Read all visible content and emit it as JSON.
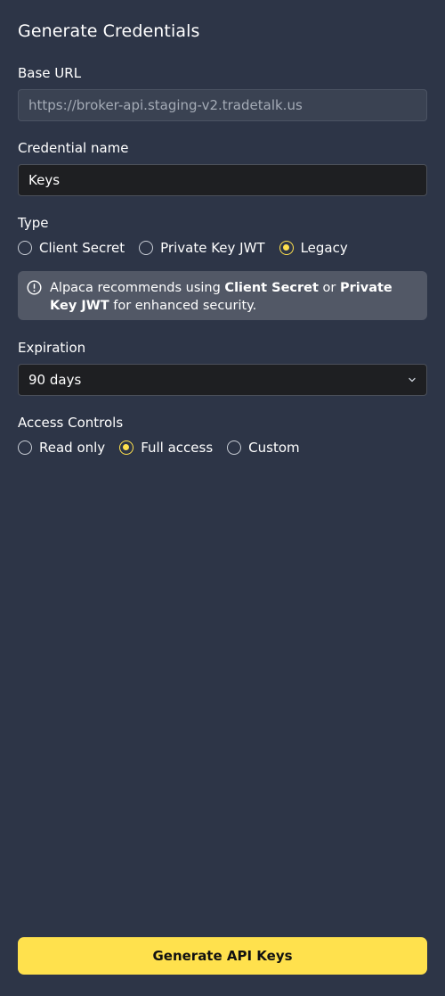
{
  "panel": {
    "title": "Generate Credentials"
  },
  "base_url": {
    "label": "Base URL",
    "value": "https://broker-api.staging-v2.tradetalk.us"
  },
  "credential_name": {
    "label": "Credential name",
    "value": "Keys"
  },
  "type": {
    "label": "Type",
    "options": [
      "Client Secret",
      "Private Key JWT",
      "Legacy"
    ],
    "selected": "Legacy"
  },
  "notice": {
    "prefix": "Alpaca recommends using ",
    "option_a": "Client Secret",
    "middle": " or ",
    "option_b": "Private Key JWT",
    "suffix": " for enhanced security.",
    "icon": "info-icon"
  },
  "expiration": {
    "label": "Expiration",
    "value": "90 days",
    "icon": "chevron-down-icon"
  },
  "access_controls": {
    "label": "Access Controls",
    "options": [
      "Read only",
      "Full access",
      "Custom"
    ],
    "selected": "Full access"
  },
  "primary_action": {
    "label": "Generate API Keys"
  },
  "colors": {
    "background": "#2d3547",
    "accent": "#ffe14d",
    "notice_bg": "#525866",
    "input_bg": "#1e1f22"
  }
}
